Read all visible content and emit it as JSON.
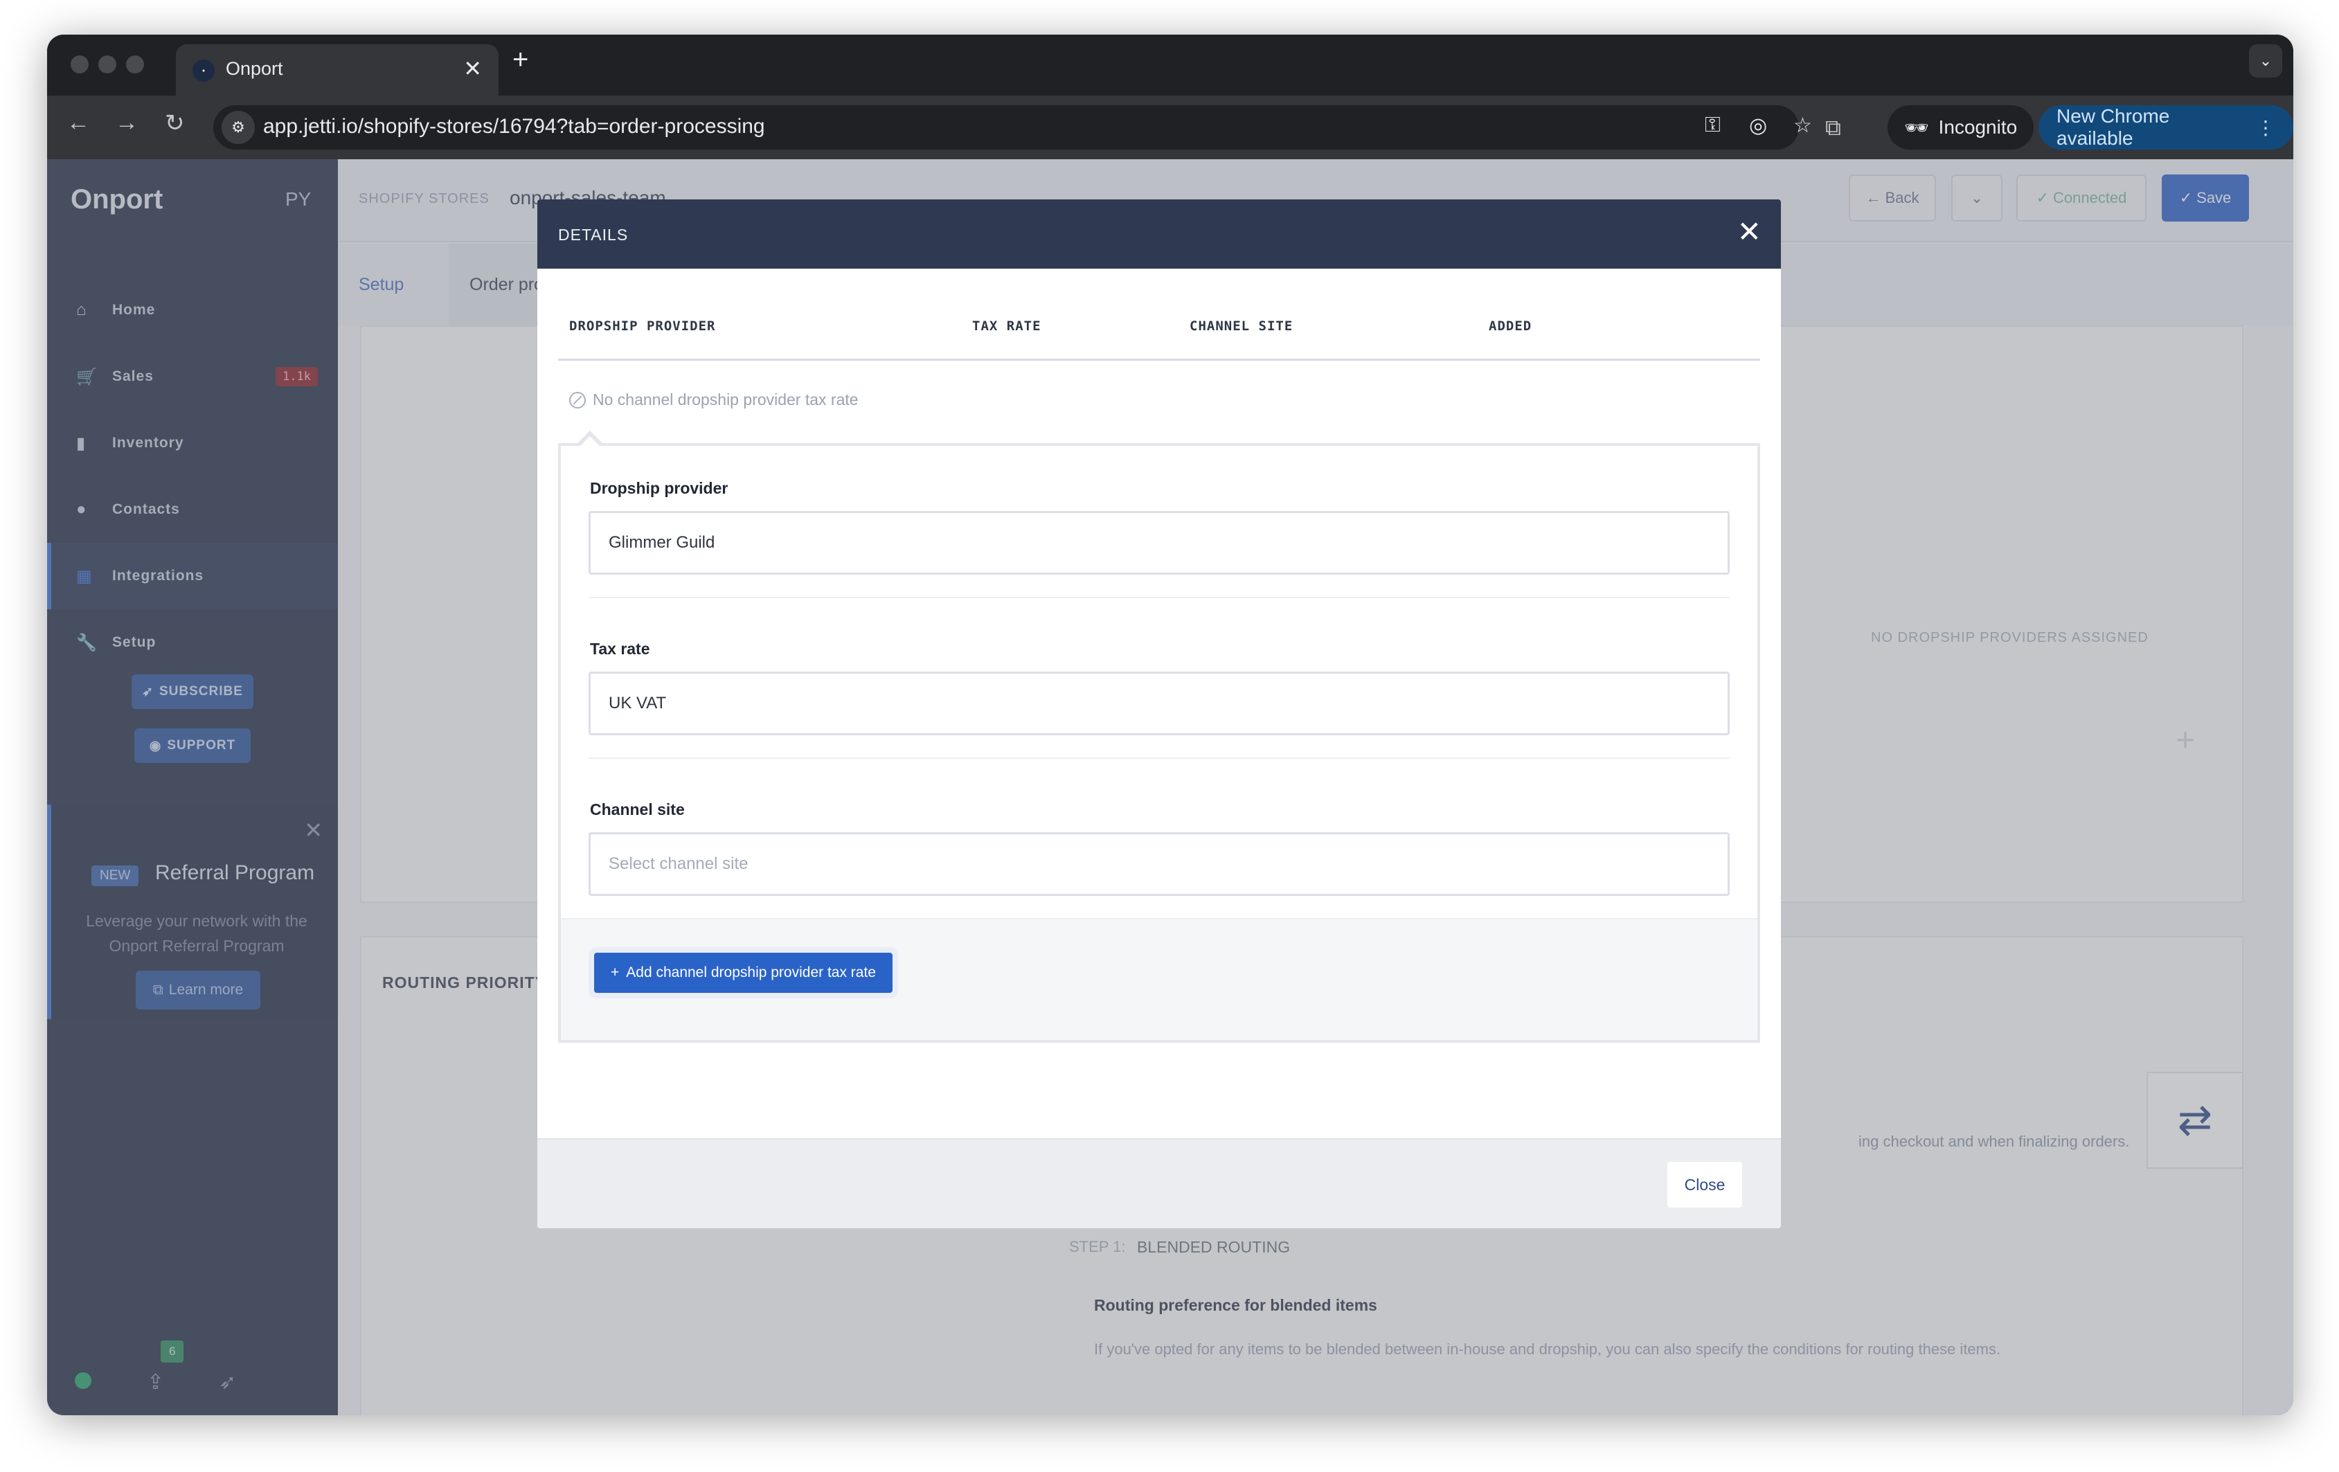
{
  "browser": {
    "tab_title": "Onport",
    "tab_close": "✕",
    "new_tab": "+",
    "url": "app.jetti.io/shopify-stores/16794?tab=order-processing",
    "incognito_label": "Incognito",
    "new_chrome_label": "New Chrome available"
  },
  "sidebar": {
    "logo": "Onport",
    "avatar": "PY",
    "items": [
      {
        "label": "Home",
        "icon": "home-icon"
      },
      {
        "label": "Sales",
        "icon": "cart-icon",
        "badge": "1.1k"
      },
      {
        "label": "Inventory",
        "icon": "bookmark-icon"
      },
      {
        "label": "Contacts",
        "icon": "person-icon"
      },
      {
        "label": "Integrations",
        "icon": "grid-icon"
      },
      {
        "label": "Setup",
        "icon": "wrench-icon"
      }
    ],
    "subscribe_label": "SUBSCRIBE",
    "support_label": "SUPPORT",
    "promo": {
      "tag": "NEW",
      "title": "Referral Program",
      "description": "Leverage your network with the Onport Referral Program",
      "button": "Learn more"
    },
    "notification_count": "6"
  },
  "page": {
    "breadcrumb_root": "SHOPIFY STORES",
    "breadcrumb_current": "onport-sales-team",
    "back_label": "Back",
    "connected_label": "Connected",
    "save_label": "Save",
    "tabs": [
      "Setup",
      "Order processing"
    ],
    "no_dropship_text": "NO DROPSHIP PROVIDERS ASSIGNED",
    "routing_priority": "ROUTING PRIORITY",
    "routing_desc_tail": "ing checkout and when finalizing orders.",
    "step_label": "STEP 1:",
    "step_title": "BLENDED ROUTING",
    "routing_pref_title": "Routing preference for blended items",
    "routing_pref_desc": "If you've opted for any items to be blended between in-house and dropship, you can also specify the conditions for routing these items."
  },
  "modal": {
    "title": "DETAILS",
    "columns": [
      "DROPSHIP PROVIDER",
      "TAX RATE",
      "CHANNEL SITE",
      "ADDED"
    ],
    "empty_text": "No channel dropship provider tax rate",
    "fields": {
      "dropship_provider_label": "Dropship provider",
      "dropship_provider_value": "Glimmer Guild",
      "tax_rate_label": "Tax rate",
      "tax_rate_value": "UK VAT",
      "channel_site_label": "Channel site",
      "channel_site_placeholder": "Select channel site"
    },
    "add_button": "Add channel dropship provider tax rate",
    "close_button": "Close"
  },
  "colors": {
    "sidebar_bg": "#232d44",
    "modal_header": "#2f3a52",
    "primary": "#2a63c8",
    "badge_red": "#8b1d25"
  }
}
